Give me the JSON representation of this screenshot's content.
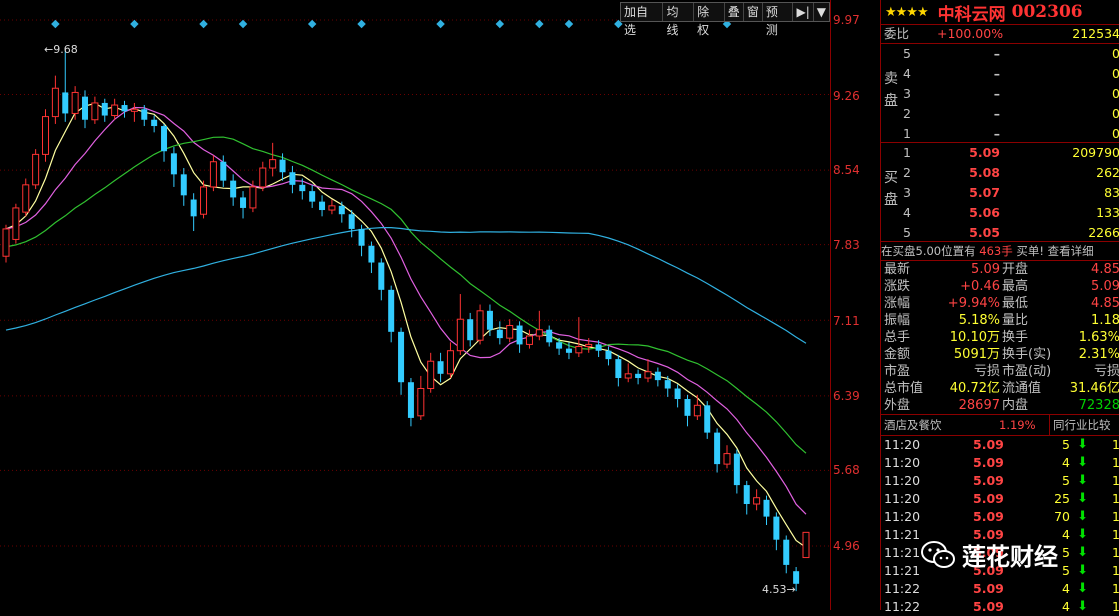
{
  "toolbar": {
    "buttons": [
      "加自选",
      "均线",
      "除权",
      "叠",
      "窗",
      "预测"
    ],
    "play_icon": "▶|",
    "menu_icon": "▼"
  },
  "chart": {
    "price_labels": [
      "9.97",
      "9.26",
      "8.54",
      "7.83",
      "7.11",
      "6.39",
      "5.68",
      "4.96"
    ],
    "high_label": "9.68",
    "low_label": "4.53"
  },
  "title": {
    "stars": "★★★★",
    "name": "中科云网",
    "code": "002306"
  },
  "weibi": {
    "label": "委比",
    "value": "+100.00%",
    "volume": "212534"
  },
  "sell_label": "卖盘",
  "buy_label": "买盘",
  "sell_book": [
    {
      "level": "5",
      "price": "–",
      "volume": "0"
    },
    {
      "level": "4",
      "price": "–",
      "volume": "0"
    },
    {
      "level": "3",
      "price": "–",
      "volume": "0"
    },
    {
      "level": "2",
      "price": "–",
      "volume": "0"
    },
    {
      "level": "1",
      "price": "–",
      "volume": "0"
    }
  ],
  "buy_book": [
    {
      "level": "1",
      "price": "5.09",
      "volume": "209790"
    },
    {
      "level": "2",
      "price": "5.08",
      "volume": "262"
    },
    {
      "level": "3",
      "price": "5.07",
      "volume": "83"
    },
    {
      "level": "4",
      "price": "5.06",
      "volume": "133"
    },
    {
      "level": "5",
      "price": "5.05",
      "volume": "2266"
    }
  ],
  "notice": {
    "prefix": "在买盘5.00位置有",
    "volume": "463手",
    "suffix": "买单!",
    "link": "查看详细"
  },
  "quotes": [
    {
      "l1": "最新",
      "v1": "5.09",
      "l2": "开盘",
      "v2": "4.85"
    },
    {
      "l1": "涨跌",
      "v1": "+0.46",
      "l2": "最高",
      "v2": "5.09"
    },
    {
      "l1": "涨幅",
      "v1": "+9.94%",
      "l2": "最低",
      "v2": "4.85"
    },
    {
      "l1": "振幅",
      "v1": "5.18%",
      "l2": "量比",
      "v2": "1.18"
    },
    {
      "l1": "总手",
      "v1": "10.10万",
      "l2": "换手",
      "v2": "1.63%"
    },
    {
      "l1": "金额",
      "v1": "5091万",
      "l2": "换手(实)",
      "v2": "2.31%"
    },
    {
      "l1": "市盈",
      "v1": "亏损",
      "l2": "市盈(动)",
      "v2": "亏损"
    },
    {
      "l1": "总市值",
      "v1": "40.72亿",
      "l2": "流通值",
      "v2": "31.46亿"
    },
    {
      "l1": "外盘",
      "v1": "28697",
      "l2": "内盘",
      "v2": "72328"
    }
  ],
  "industry": {
    "name": "酒店及餐饮",
    "change": "1.19%",
    "compare": "同行业比较"
  },
  "ticks": [
    {
      "time": "11:20",
      "price": "5.09",
      "volume": "5",
      "edge": "1"
    },
    {
      "time": "11:20",
      "price": "5.09",
      "volume": "4",
      "edge": "1"
    },
    {
      "time": "11:20",
      "price": "5.09",
      "volume": "5",
      "edge": "1"
    },
    {
      "time": "11:20",
      "price": "5.09",
      "volume": "25",
      "edge": "1"
    },
    {
      "time": "11:20",
      "price": "5.09",
      "volume": "70",
      "edge": "1"
    },
    {
      "time": "11:21",
      "price": "5.09",
      "volume": "4",
      "edge": "1"
    },
    {
      "time": "11:21",
      "price": "5.09",
      "volume": "5",
      "edge": "1"
    },
    {
      "time": "11:21",
      "price": "5.09",
      "volume": "5",
      "edge": "1"
    },
    {
      "time": "11:22",
      "price": "5.09",
      "volume": "4",
      "edge": "1"
    },
    {
      "time": "11:22",
      "price": "5.09",
      "volume": "4",
      "edge": "1"
    }
  ],
  "watermark": {
    "text": "莲花财经"
  },
  "colors": {
    "up": "#ff3333",
    "down": "#33ccff",
    "ma5": "#ffffa0",
    "ma10": "#e060e0",
    "ma20": "#30c030",
    "ma60": "#30b0e0",
    "grid": "#6b0000"
  },
  "candles": [
    [
      7.72,
      7.98,
      7.66,
      8.02
    ],
    [
      7.88,
      8.18,
      7.84,
      8.22
    ],
    [
      8.14,
      8.4,
      8.1,
      8.46
    ],
    [
      8.4,
      8.69,
      8.36,
      8.74
    ],
    [
      8.69,
      9.05,
      8.62,
      9.12
    ],
    [
      9.05,
      9.32,
      8.98,
      9.44
    ],
    [
      9.28,
      9.08,
      9.0,
      9.68
    ],
    [
      9.08,
      9.28,
      9.02,
      9.34
    ],
    [
      9.24,
      9.02,
      8.94,
      9.3
    ],
    [
      9.02,
      9.18,
      8.98,
      9.24
    ],
    [
      9.18,
      9.06,
      9.0,
      9.22
    ],
    [
      9.06,
      9.16,
      9.02,
      9.22
    ],
    [
      9.16,
      9.1,
      9.04,
      9.2
    ],
    [
      9.1,
      9.12,
      9.0,
      9.18
    ],
    [
      9.12,
      9.02,
      8.96,
      9.16
    ],
    [
      9.02,
      8.96,
      8.9,
      9.06
    ],
    [
      8.96,
      8.72,
      8.62,
      8.98
    ],
    [
      8.7,
      8.5,
      8.38,
      8.76
    ],
    [
      8.5,
      8.3,
      8.2,
      8.56
    ],
    [
      8.26,
      8.1,
      7.96,
      8.32
    ],
    [
      8.12,
      8.38,
      8.08,
      8.44
    ],
    [
      8.38,
      8.62,
      8.34,
      8.68
    ],
    [
      8.62,
      8.44,
      8.38,
      8.68
    ],
    [
      8.44,
      8.28,
      8.2,
      8.5
    ],
    [
      8.28,
      8.18,
      8.08,
      8.34
    ],
    [
      8.18,
      8.38,
      8.14,
      8.44
    ],
    [
      8.38,
      8.56,
      8.34,
      8.62
    ],
    [
      8.56,
      8.64,
      8.48,
      8.8
    ],
    [
      8.64,
      8.52,
      8.44,
      8.7
    ],
    [
      8.52,
      8.4,
      8.32,
      8.58
    ],
    [
      8.4,
      8.34,
      8.26,
      8.46
    ],
    [
      8.34,
      8.24,
      8.18,
      8.4
    ],
    [
      8.24,
      8.16,
      8.1,
      8.3
    ],
    [
      8.16,
      8.2,
      8.12,
      8.26
    ],
    [
      8.2,
      8.12,
      8.04,
      8.24
    ],
    [
      8.12,
      7.98,
      7.9,
      8.16
    ],
    [
      7.98,
      7.82,
      7.72,
      8.02
    ],
    [
      7.82,
      7.66,
      7.56,
      7.86
    ],
    [
      7.66,
      7.4,
      7.3,
      7.7
    ],
    [
      7.4,
      7.0,
      6.9,
      7.44
    ],
    [
      7.0,
      6.52,
      6.4,
      7.04
    ],
    [
      6.52,
      6.18,
      6.1,
      6.56
    ],
    [
      6.2,
      6.46,
      6.16,
      6.58
    ],
    [
      6.46,
      6.72,
      6.42,
      6.8
    ],
    [
      6.72,
      6.6,
      6.52,
      6.8
    ],
    [
      6.6,
      6.82,
      6.56,
      6.9
    ],
    [
      6.82,
      7.12,
      6.78,
      7.36
    ],
    [
      7.12,
      6.92,
      6.86,
      7.18
    ],
    [
      6.92,
      7.2,
      6.88,
      7.26
    ],
    [
      7.2,
      7.02,
      6.96,
      7.26
    ],
    [
      7.02,
      6.94,
      6.88,
      7.1
    ],
    [
      6.94,
      7.06,
      6.9,
      7.12
    ],
    [
      7.06,
      6.88,
      6.8,
      7.1
    ],
    [
      6.88,
      6.96,
      6.84,
      7.02
    ],
    [
      6.96,
      7.02,
      6.92,
      7.2
    ],
    [
      7.02,
      6.9,
      6.86,
      7.06
    ],
    [
      6.9,
      6.84,
      6.78,
      6.94
    ],
    [
      6.84,
      6.8,
      6.74,
      6.9
    ],
    [
      6.8,
      6.86,
      6.76,
      7.14
    ],
    [
      6.86,
      6.88,
      6.8,
      6.94
    ],
    [
      6.88,
      6.82,
      6.76,
      6.92
    ],
    [
      6.82,
      6.74,
      6.68,
      6.86
    ],
    [
      6.74,
      6.56,
      6.48,
      6.78
    ],
    [
      6.56,
      6.6,
      6.52,
      6.7
    ],
    [
      6.6,
      6.56,
      6.5,
      6.64
    ],
    [
      6.56,
      6.62,
      6.52,
      6.74
    ],
    [
      6.62,
      6.54,
      6.48,
      6.66
    ],
    [
      6.54,
      6.46,
      6.38,
      6.58
    ],
    [
      6.46,
      6.36,
      6.28,
      6.5
    ],
    [
      6.36,
      6.2,
      6.1,
      6.4
    ],
    [
      6.2,
      6.3,
      6.16,
      6.4
    ],
    [
      6.3,
      6.04,
      5.98,
      6.34
    ],
    [
      6.04,
      5.74,
      5.66,
      6.08
    ],
    [
      5.74,
      5.84,
      5.7,
      5.92
    ],
    [
      5.84,
      5.54,
      5.46,
      5.88
    ],
    [
      5.54,
      5.36,
      5.26,
      5.58
    ],
    [
      5.36,
      5.42,
      5.3,
      5.5
    ],
    [
      5.4,
      5.24,
      5.16,
      5.44
    ],
    [
      5.24,
      5.02,
      4.92,
      5.28
    ],
    [
      5.02,
      4.78,
      4.7,
      5.06
    ],
    [
      4.72,
      4.6,
      4.53,
      4.76
    ],
    [
      4.85,
      5.09,
      4.85,
      5.09
    ]
  ]
}
